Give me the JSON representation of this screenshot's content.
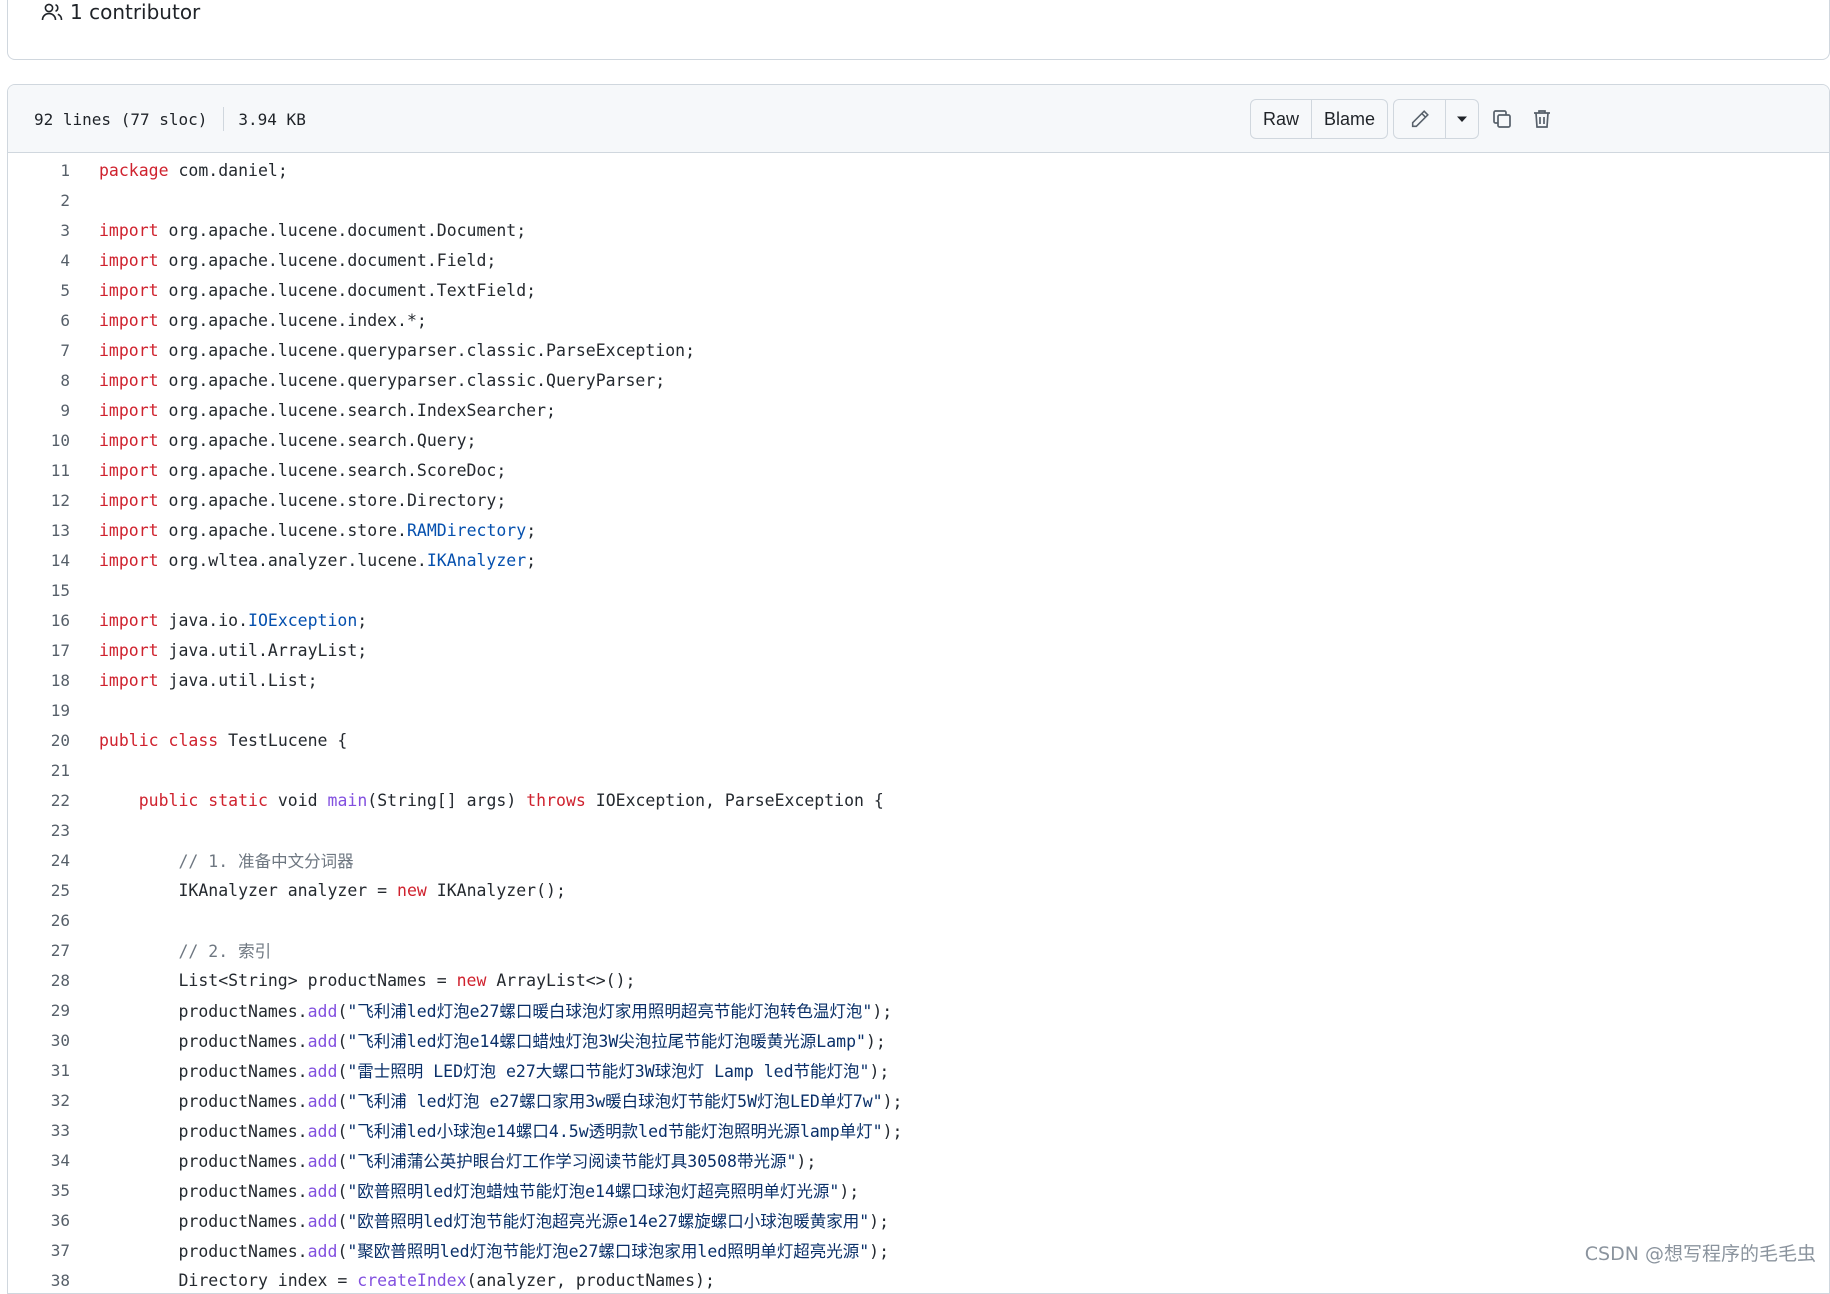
{
  "contributors": {
    "label": "1 contributor"
  },
  "file": {
    "lines": "92 lines (77 sloc)",
    "size": "3.94 KB"
  },
  "toolbar": {
    "raw": "Raw",
    "blame": "Blame"
  },
  "code": [
    {
      "n": "1",
      "t": [
        {
          "c": "kw",
          "v": "package"
        },
        {
          "c": "",
          "v": " com.daniel;"
        }
      ]
    },
    {
      "n": "2",
      "t": []
    },
    {
      "n": "3",
      "t": [
        {
          "c": "kw",
          "v": "import"
        },
        {
          "c": "",
          "v": " org.apache.lucene.document.Document;"
        }
      ]
    },
    {
      "n": "4",
      "t": [
        {
          "c": "kw",
          "v": "import"
        },
        {
          "c": "",
          "v": " org.apache.lucene.document.Field;"
        }
      ]
    },
    {
      "n": "5",
      "t": [
        {
          "c": "kw",
          "v": "import"
        },
        {
          "c": "",
          "v": " org.apache.lucene.document.TextField;"
        }
      ]
    },
    {
      "n": "6",
      "t": [
        {
          "c": "kw",
          "v": "import"
        },
        {
          "c": "",
          "v": " org.apache.lucene.index.*;"
        }
      ]
    },
    {
      "n": "7",
      "t": [
        {
          "c": "kw",
          "v": "import"
        },
        {
          "c": "",
          "v": " org.apache.lucene.queryparser.classic.ParseException;"
        }
      ]
    },
    {
      "n": "8",
      "t": [
        {
          "c": "kw",
          "v": "import"
        },
        {
          "c": "",
          "v": " org.apache.lucene.queryparser.classic.QueryParser;"
        }
      ]
    },
    {
      "n": "9",
      "t": [
        {
          "c": "kw",
          "v": "import"
        },
        {
          "c": "",
          "v": " org.apache.lucene.search.IndexSearcher;"
        }
      ]
    },
    {
      "n": "10",
      "t": [
        {
          "c": "kw",
          "v": "import"
        },
        {
          "c": "",
          "v": " org.apache.lucene.search.Query;"
        }
      ]
    },
    {
      "n": "11",
      "t": [
        {
          "c": "kw",
          "v": "import"
        },
        {
          "c": "",
          "v": " org.apache.lucene.search.ScoreDoc;"
        }
      ]
    },
    {
      "n": "12",
      "t": [
        {
          "c": "kw",
          "v": "import"
        },
        {
          "c": "",
          "v": " org.apache.lucene.store.Directory;"
        }
      ]
    },
    {
      "n": "13",
      "t": [
        {
          "c": "kw",
          "v": "import"
        },
        {
          "c": "",
          "v": " org.apache.lucene.store."
        },
        {
          "c": "ty",
          "v": "RAMDirectory"
        },
        {
          "c": "",
          "v": ";"
        }
      ]
    },
    {
      "n": "14",
      "t": [
        {
          "c": "kw",
          "v": "import"
        },
        {
          "c": "",
          "v": " org.wltea.analyzer.lucene."
        },
        {
          "c": "ty",
          "v": "IKAnalyzer"
        },
        {
          "c": "",
          "v": ";"
        }
      ]
    },
    {
      "n": "15",
      "t": []
    },
    {
      "n": "16",
      "t": [
        {
          "c": "kw",
          "v": "import"
        },
        {
          "c": "",
          "v": " java.io."
        },
        {
          "c": "ty",
          "v": "IOException"
        },
        {
          "c": "",
          "v": ";"
        }
      ]
    },
    {
      "n": "17",
      "t": [
        {
          "c": "kw",
          "v": "import"
        },
        {
          "c": "",
          "v": " java.util.ArrayList;"
        }
      ]
    },
    {
      "n": "18",
      "t": [
        {
          "c": "kw",
          "v": "import"
        },
        {
          "c": "",
          "v": " java.util.List;"
        }
      ]
    },
    {
      "n": "19",
      "t": []
    },
    {
      "n": "20",
      "t": [
        {
          "c": "kw",
          "v": "public"
        },
        {
          "c": "",
          "v": " "
        },
        {
          "c": "kw",
          "v": "class"
        },
        {
          "c": "",
          "v": " TestLucene {"
        }
      ]
    },
    {
      "n": "21",
      "t": []
    },
    {
      "n": "22",
      "t": [
        {
          "c": "",
          "v": "    "
        },
        {
          "c": "kw",
          "v": "public"
        },
        {
          "c": "",
          "v": " "
        },
        {
          "c": "kw",
          "v": "static"
        },
        {
          "c": "",
          "v": " void "
        },
        {
          "c": "fn",
          "v": "main"
        },
        {
          "c": "",
          "v": "(String[] args) "
        },
        {
          "c": "kw",
          "v": "throws"
        },
        {
          "c": "",
          "v": " IOException, ParseException {"
        }
      ]
    },
    {
      "n": "23",
      "t": []
    },
    {
      "n": "24",
      "t": [
        {
          "c": "",
          "v": "        "
        },
        {
          "c": "cm",
          "v": "// 1. 准备中文分词器"
        }
      ]
    },
    {
      "n": "25",
      "t": [
        {
          "c": "",
          "v": "        IKAnalyzer analyzer = "
        },
        {
          "c": "kw",
          "v": "new"
        },
        {
          "c": "",
          "v": " IKAnalyzer();"
        }
      ]
    },
    {
      "n": "26",
      "t": []
    },
    {
      "n": "27",
      "t": [
        {
          "c": "",
          "v": "        "
        },
        {
          "c": "cm",
          "v": "// 2. 索引"
        }
      ]
    },
    {
      "n": "28",
      "t": [
        {
          "c": "",
          "v": "        List<String> productNames = "
        },
        {
          "c": "kw",
          "v": "new"
        },
        {
          "c": "",
          "v": " ArrayList<>();"
        }
      ]
    },
    {
      "n": "29",
      "t": [
        {
          "c": "",
          "v": "        productNames."
        },
        {
          "c": "fn",
          "v": "add"
        },
        {
          "c": "",
          "v": "("
        },
        {
          "c": "str",
          "v": "\"飞利浦led灯泡e27螺口暖白球泡灯家用照明超亮节能灯泡转色温灯泡\""
        },
        {
          "c": "",
          "v": ");"
        }
      ]
    },
    {
      "n": "30",
      "t": [
        {
          "c": "",
          "v": "        productNames."
        },
        {
          "c": "fn",
          "v": "add"
        },
        {
          "c": "",
          "v": "("
        },
        {
          "c": "str",
          "v": "\"飞利浦led灯泡e14螺口蜡烛灯泡3W尖泡拉尾节能灯泡暖黄光源Lamp\""
        },
        {
          "c": "",
          "v": ");"
        }
      ]
    },
    {
      "n": "31",
      "t": [
        {
          "c": "",
          "v": "        productNames."
        },
        {
          "c": "fn",
          "v": "add"
        },
        {
          "c": "",
          "v": "("
        },
        {
          "c": "str",
          "v": "\"雷士照明 LED灯泡 e27大螺口节能灯3W球泡灯 Lamp led节能灯泡\""
        },
        {
          "c": "",
          "v": ");"
        }
      ]
    },
    {
      "n": "32",
      "t": [
        {
          "c": "",
          "v": "        productNames."
        },
        {
          "c": "fn",
          "v": "add"
        },
        {
          "c": "",
          "v": "("
        },
        {
          "c": "str",
          "v": "\"飞利浦 led灯泡 e27螺口家用3w暖白球泡灯节能灯5W灯泡LED单灯7w\""
        },
        {
          "c": "",
          "v": ");"
        }
      ]
    },
    {
      "n": "33",
      "t": [
        {
          "c": "",
          "v": "        productNames."
        },
        {
          "c": "fn",
          "v": "add"
        },
        {
          "c": "",
          "v": "("
        },
        {
          "c": "str",
          "v": "\"飞利浦led小球泡e14螺口4.5w透明款led节能灯泡照明光源lamp单灯\""
        },
        {
          "c": "",
          "v": ");"
        }
      ]
    },
    {
      "n": "34",
      "t": [
        {
          "c": "",
          "v": "        productNames."
        },
        {
          "c": "fn",
          "v": "add"
        },
        {
          "c": "",
          "v": "("
        },
        {
          "c": "str",
          "v": "\"飞利浦蒲公英护眼台灯工作学习阅读节能灯具30508带光源\""
        },
        {
          "c": "",
          "v": ");"
        }
      ]
    },
    {
      "n": "35",
      "t": [
        {
          "c": "",
          "v": "        productNames."
        },
        {
          "c": "fn",
          "v": "add"
        },
        {
          "c": "",
          "v": "("
        },
        {
          "c": "str",
          "v": "\"欧普照明led灯泡蜡烛节能灯泡e14螺口球泡灯超亮照明单灯光源\""
        },
        {
          "c": "",
          "v": ");"
        }
      ]
    },
    {
      "n": "36",
      "t": [
        {
          "c": "",
          "v": "        productNames."
        },
        {
          "c": "fn",
          "v": "add"
        },
        {
          "c": "",
          "v": "("
        },
        {
          "c": "str",
          "v": "\"欧普照明led灯泡节能灯泡超亮光源e14e27螺旋螺口小球泡暖黄家用\""
        },
        {
          "c": "",
          "v": ");"
        }
      ]
    },
    {
      "n": "37",
      "t": [
        {
          "c": "",
          "v": "        productNames."
        },
        {
          "c": "fn",
          "v": "add"
        },
        {
          "c": "",
          "v": "("
        },
        {
          "c": "str",
          "v": "\"聚欧普照明led灯泡节能灯泡e27螺口球泡家用led照明单灯超亮光源\""
        },
        {
          "c": "",
          "v": ");"
        }
      ]
    },
    {
      "n": "38",
      "t": [
        {
          "c": "",
          "v": "        Directory index = "
        },
        {
          "c": "fn",
          "v": "createIndex"
        },
        {
          "c": "",
          "v": "(analyzer, productNames);"
        }
      ]
    }
  ],
  "watermark": "CSDN @想写程序的毛毛虫"
}
